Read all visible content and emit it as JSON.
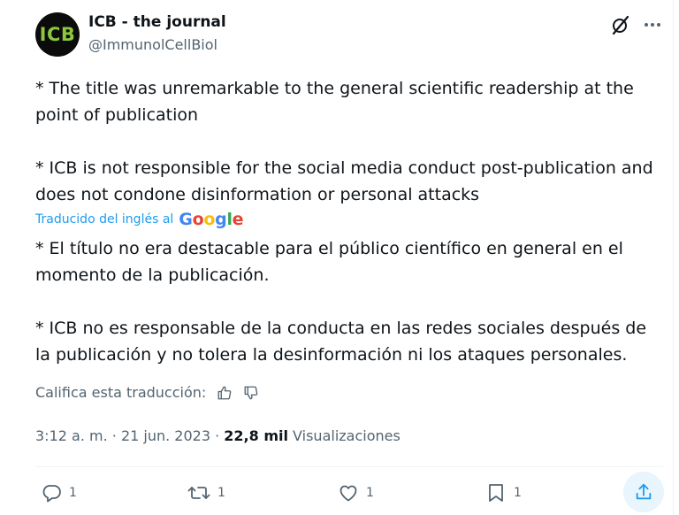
{
  "author": {
    "avatar_text": "ICB",
    "name": "ICB - the journal",
    "handle": "@ImmunolCellBiol"
  },
  "tweet": {
    "original": [
      "* The title was unremarkable to the general scientific readership at the point of publication",
      "* ICB is not responsible for the social media conduct post-publication and does not condone disinformation or personal attacks"
    ],
    "translated_label": "Traducido del inglés al",
    "translator_brand": [
      "G",
      "o",
      "o",
      "g",
      "l",
      "e"
    ],
    "translation": [
      "* El título no era destacable para el público científico en general en el momento de la publicación.",
      "* ICB no es responsable de la conducta en las redes sociales después de la publicación y no tolera la desinformación ni los ataques personales."
    ],
    "rate_label": "Califica esta traducción:"
  },
  "meta": {
    "time": "3:12 a. m.",
    "separator": " · ",
    "date": "21 jun. 2023",
    "views_count": "22,8 mil",
    "views_label": "Visualizaciones"
  },
  "actions": {
    "replies": "1",
    "reposts": "1",
    "likes": "1",
    "bookmarks": "1"
  },
  "colors": {
    "accent": "#1d9bf0",
    "text": "#0f1419",
    "muted": "#536471",
    "avatar_bg": "#0b0b0b",
    "avatar_fg": "#8dc63f",
    "google": [
      "#4285f4",
      "#ea4335",
      "#fbbc05",
      "#4285f4",
      "#34a853",
      "#ea4335"
    ]
  },
  "icons": [
    "grok-icon",
    "more-icon",
    "thumbs-up-icon",
    "thumbs-down-icon",
    "reply-icon",
    "retweet-icon",
    "like-icon",
    "bookmark-icon",
    "share-icon"
  ]
}
